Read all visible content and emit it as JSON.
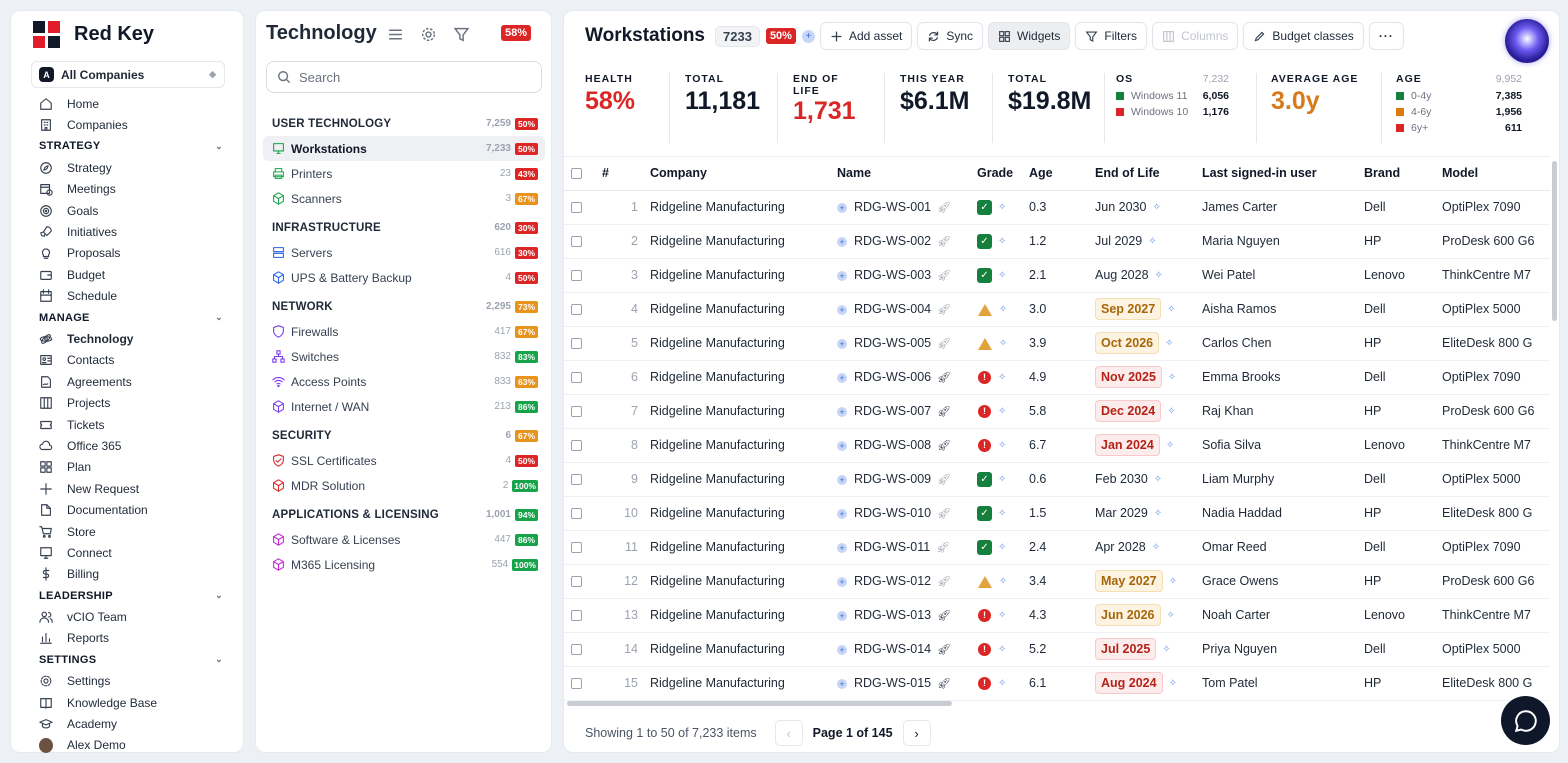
{
  "brand": {
    "name": "Red Key"
  },
  "company_selector": {
    "badge": "A",
    "label": "All Companies"
  },
  "sidebar": {
    "items": [
      {
        "type": "item",
        "label": "Home",
        "icon": "home-icon"
      },
      {
        "type": "item",
        "label": "Companies",
        "icon": "building-icon"
      },
      {
        "type": "section",
        "label": "STRATEGY"
      },
      {
        "type": "item",
        "label": "Strategy",
        "icon": "compass-icon"
      },
      {
        "type": "item",
        "label": "Meetings",
        "icon": "calendar-clock-icon"
      },
      {
        "type": "item",
        "label": "Goals",
        "icon": "target-icon"
      },
      {
        "type": "item",
        "label": "Initiatives",
        "icon": "rocket-icon"
      },
      {
        "type": "item",
        "label": "Proposals",
        "icon": "lightbulb-icon"
      },
      {
        "type": "item",
        "label": "Budget",
        "icon": "wallet-icon"
      },
      {
        "type": "item",
        "label": "Schedule",
        "icon": "calendar-icon"
      },
      {
        "type": "section",
        "label": "MANAGE"
      },
      {
        "type": "item",
        "label": "Technology",
        "icon": "atom-icon",
        "active": true
      },
      {
        "type": "item",
        "label": "Contacts",
        "icon": "contact-card-icon"
      },
      {
        "type": "item",
        "label": "Agreements",
        "icon": "file-sign-icon"
      },
      {
        "type": "item",
        "label": "Projects",
        "icon": "kanban-icon"
      },
      {
        "type": "item",
        "label": "Tickets",
        "icon": "ticket-icon"
      },
      {
        "type": "item",
        "label": "Office 365",
        "icon": "cloud-icon"
      },
      {
        "type": "item",
        "label": "Plan",
        "icon": "grid-icon"
      },
      {
        "type": "item",
        "label": "New Request",
        "icon": "plus-icon"
      },
      {
        "type": "item",
        "label": "Documentation",
        "icon": "document-icon"
      },
      {
        "type": "item",
        "label": "Store",
        "icon": "cart-icon"
      },
      {
        "type": "item",
        "label": "Connect",
        "icon": "monitor-icon"
      },
      {
        "type": "item",
        "label": "Billing",
        "icon": "dollar-icon"
      },
      {
        "type": "section",
        "label": "LEADERSHIP"
      },
      {
        "type": "item",
        "label": "vCIO Team",
        "icon": "users-icon"
      },
      {
        "type": "item",
        "label": "Reports",
        "icon": "bar-chart-icon"
      },
      {
        "type": "section",
        "label": "SETTINGS"
      },
      {
        "type": "item",
        "label": "Settings",
        "icon": "gear-icon"
      },
      {
        "type": "item",
        "label": "Knowledge Base",
        "icon": "book-icon"
      },
      {
        "type": "item",
        "label": "Academy",
        "icon": "graduation-cap-icon"
      },
      {
        "type": "item",
        "label": "Alex Demo",
        "icon": "avatar"
      }
    ]
  },
  "tech_panel": {
    "title": "Technology",
    "pct": "58%",
    "search_placeholder": "Search",
    "groups": [
      {
        "name": "USER TECHNOLOGY",
        "count": "7,259",
        "pct": "50%",
        "color": "#dc2626",
        "items": [
          {
            "name": "Workstations",
            "count": "7,233",
            "pct": "50%",
            "color": "#dc2626",
            "icon": "monitor-icon",
            "iconColor": "#16a34a",
            "selected": true
          },
          {
            "name": "Printers",
            "count": "23",
            "pct": "43%",
            "color": "#dc2626",
            "icon": "printer-icon",
            "iconColor": "#16a34a"
          },
          {
            "name": "Scanners",
            "count": "3",
            "pct": "67%",
            "color": "#e8931b",
            "icon": "box-icon",
            "iconColor": "#16a34a"
          }
        ]
      },
      {
        "name": "INFRASTRUCTURE",
        "count": "620",
        "pct": "30%",
        "color": "#dc2626",
        "items": [
          {
            "name": "Servers",
            "count": "616",
            "pct": "30%",
            "color": "#dc2626",
            "icon": "server-icon",
            "iconColor": "#2563eb"
          },
          {
            "name": "UPS & Battery Backup",
            "count": "4",
            "pct": "50%",
            "color": "#dc2626",
            "icon": "box-icon",
            "iconColor": "#2563eb"
          }
        ]
      },
      {
        "name": "NETWORK",
        "count": "2,295",
        "pct": "73%",
        "color": "#e8931b",
        "items": [
          {
            "name": "Firewalls",
            "count": "417",
            "pct": "67%",
            "color": "#e8931b",
            "icon": "shield-icon",
            "iconColor": "#7c3aed"
          },
          {
            "name": "Switches",
            "count": "832",
            "pct": "83%",
            "color": "#16a34a",
            "icon": "network-icon",
            "iconColor": "#7c3aed"
          },
          {
            "name": "Access Points",
            "count": "833",
            "pct": "63%",
            "color": "#e8931b",
            "icon": "wifi-icon",
            "iconColor": "#7c3aed"
          },
          {
            "name": "Internet / WAN",
            "count": "213",
            "pct": "86%",
            "color": "#16a34a",
            "icon": "box-icon",
            "iconColor": "#7c3aed"
          }
        ]
      },
      {
        "name": "SECURITY",
        "count": "6",
        "pct": "67%",
        "color": "#e8931b",
        "items": [
          {
            "name": "SSL Certificates",
            "count": "4",
            "pct": "50%",
            "color": "#dc2626",
            "icon": "shield-check-icon",
            "iconColor": "#dc2626"
          },
          {
            "name": "MDR Solution",
            "count": "2",
            "pct": "100%",
            "color": "#16a34a",
            "icon": "box-icon",
            "iconColor": "#dc2626"
          }
        ]
      },
      {
        "name": "APPLICATIONS & LICENSING",
        "count": "1,001",
        "pct": "94%",
        "color": "#16a34a",
        "items": [
          {
            "name": "Software & Licenses",
            "count": "447",
            "pct": "86%",
            "color": "#16a34a",
            "icon": "box-icon",
            "iconColor": "#c026d3"
          },
          {
            "name": "M365 Licensing",
            "count": "554",
            "pct": "100%",
            "color": "#16a34a",
            "icon": "box-icon",
            "iconColor": "#c026d3"
          }
        ]
      }
    ]
  },
  "header": {
    "title": "Workstations",
    "count": "7233",
    "pct": "50%",
    "buttons": {
      "add": "Add asset",
      "sync": "Sync",
      "widgets": "Widgets",
      "filters": "Filters",
      "columns": "Columns",
      "budget": "Budget classes"
    }
  },
  "stats": {
    "health": {
      "label": "HEALTH",
      "value": "58%"
    },
    "total": {
      "label": "TOTAL",
      "value": "11,181"
    },
    "eol": {
      "label1": "END OF",
      "label2": "LIFE",
      "value": "1,731"
    },
    "this_year": {
      "label": "THIS YEAR",
      "value": "$6.1M"
    },
    "total_cost": {
      "label": "TOTAL",
      "value": "$19.8M"
    },
    "os": {
      "label": "OS",
      "total": "7,232",
      "rows": [
        {
          "name": "Windows 11",
          "value": "6,056",
          "color": "#15803d"
        },
        {
          "name": "Windows 10",
          "value": "1,176",
          "color": "#dc2626"
        }
      ]
    },
    "avg_age": {
      "label": "AVERAGE AGE",
      "value": "3.0y"
    },
    "age": {
      "label": "AGE",
      "total": "9,952",
      "rows": [
        {
          "name": "0-4y",
          "value": "7,385",
          "color": "#15803d"
        },
        {
          "name": "4-6y",
          "value": "1,956",
          "color": "#e07a10"
        },
        {
          "name": "6y+",
          "value": "611",
          "color": "#dc2626"
        }
      ]
    }
  },
  "table": {
    "columns": [
      "#",
      "Company",
      "Name",
      "Grade",
      "Age",
      "End of Life",
      "Last signed-in user",
      "Brand",
      "Model"
    ],
    "rows": [
      {
        "n": "1",
        "company": "Ridgeline Manufacturing",
        "name": "RDG-WS-001",
        "grade": "ok",
        "age": "0.3",
        "eol": "Jun 2030",
        "eol_status": "ok",
        "user": "James Carter",
        "brand": "Dell",
        "model": "OptiPlex 7090"
      },
      {
        "n": "2",
        "company": "Ridgeline Manufacturing",
        "name": "RDG-WS-002",
        "grade": "ok",
        "age": "1.2",
        "eol": "Jul 2029",
        "eol_status": "ok",
        "user": "Maria Nguyen",
        "brand": "HP",
        "model": "ProDesk 600 G6"
      },
      {
        "n": "3",
        "company": "Ridgeline Manufacturing",
        "name": "RDG-WS-003",
        "grade": "ok",
        "age": "2.1",
        "eol": "Aug 2028",
        "eol_status": "ok",
        "user": "Wei Patel",
        "brand": "Lenovo",
        "model": "ThinkCentre M7"
      },
      {
        "n": "4",
        "company": "Ridgeline Manufacturing",
        "name": "RDG-WS-004",
        "grade": "warn",
        "age": "3.0",
        "eol": "Sep 2027",
        "eol_status": "warn",
        "user": "Aisha Ramos",
        "brand": "Dell",
        "model": "OptiPlex 5000"
      },
      {
        "n": "5",
        "company": "Ridgeline Manufacturing",
        "name": "RDG-WS-005",
        "grade": "warn",
        "age": "3.9",
        "eol": "Oct 2026",
        "eol_status": "warn",
        "user": "Carlos Chen",
        "brand": "HP",
        "model": "EliteDesk 800 G"
      },
      {
        "n": "6",
        "company": "Ridgeline Manufacturing",
        "name": "RDG-WS-006",
        "grade": "bad",
        "age": "4.9",
        "eol": "Nov 2025",
        "eol_status": "bad",
        "user": "Emma Brooks",
        "brand": "Dell",
        "model": "OptiPlex 7090"
      },
      {
        "n": "7",
        "company": "Ridgeline Manufacturing",
        "name": "RDG-WS-007",
        "grade": "bad",
        "age": "5.8",
        "eol": "Dec 2024",
        "eol_status": "bad",
        "user": "Raj Khan",
        "brand": "HP",
        "model": "ProDesk 600 G6"
      },
      {
        "n": "8",
        "company": "Ridgeline Manufacturing",
        "name": "RDG-WS-008",
        "grade": "bad",
        "age": "6.7",
        "eol": "Jan 2024",
        "eol_status": "bad",
        "user": "Sofia Silva",
        "brand": "Lenovo",
        "model": "ThinkCentre M7"
      },
      {
        "n": "9",
        "company": "Ridgeline Manufacturing",
        "name": "RDG-WS-009",
        "grade": "ok",
        "age": "0.6",
        "eol": "Feb 2030",
        "eol_status": "ok",
        "user": "Liam Murphy",
        "brand": "Dell",
        "model": "OptiPlex 5000"
      },
      {
        "n": "10",
        "company": "Ridgeline Manufacturing",
        "name": "RDG-WS-010",
        "grade": "ok",
        "age": "1.5",
        "eol": "Mar 2029",
        "eol_status": "ok",
        "user": "Nadia Haddad",
        "brand": "HP",
        "model": "EliteDesk 800 G"
      },
      {
        "n": "11",
        "company": "Ridgeline Manufacturing",
        "name": "RDG-WS-011",
        "grade": "ok",
        "age": "2.4",
        "eol": "Apr 2028",
        "eol_status": "ok",
        "user": "Omar Reed",
        "brand": "Dell",
        "model": "OptiPlex 7090"
      },
      {
        "n": "12",
        "company": "Ridgeline Manufacturing",
        "name": "RDG-WS-012",
        "grade": "warn",
        "age": "3.4",
        "eol": "May 2027",
        "eol_status": "warn",
        "user": "Grace Owens",
        "brand": "HP",
        "model": "ProDesk 600 G6"
      },
      {
        "n": "13",
        "company": "Ridgeline Manufacturing",
        "name": "RDG-WS-013",
        "grade": "bad",
        "age": "4.3",
        "eol": "Jun 2026",
        "eol_status": "warn",
        "user": "Noah Carter",
        "brand": "Lenovo",
        "model": "ThinkCentre M7"
      },
      {
        "n": "14",
        "company": "Ridgeline Manufacturing",
        "name": "RDG-WS-014",
        "grade": "bad",
        "age": "5.2",
        "eol": "Jul 2025",
        "eol_status": "bad",
        "user": "Priya Nguyen",
        "brand": "Dell",
        "model": "OptiPlex 5000"
      },
      {
        "n": "15",
        "company": "Ridgeline Manufacturing",
        "name": "RDG-WS-015",
        "grade": "bad",
        "age": "6.1",
        "eol": "Aug 2024",
        "eol_status": "bad",
        "user": "Tom Patel",
        "brand": "HP",
        "model": "EliteDesk 800 G"
      }
    ]
  },
  "footer": {
    "showing": "Showing 1 to 50 of 7,233 items",
    "page": "Page 1 of 145"
  }
}
